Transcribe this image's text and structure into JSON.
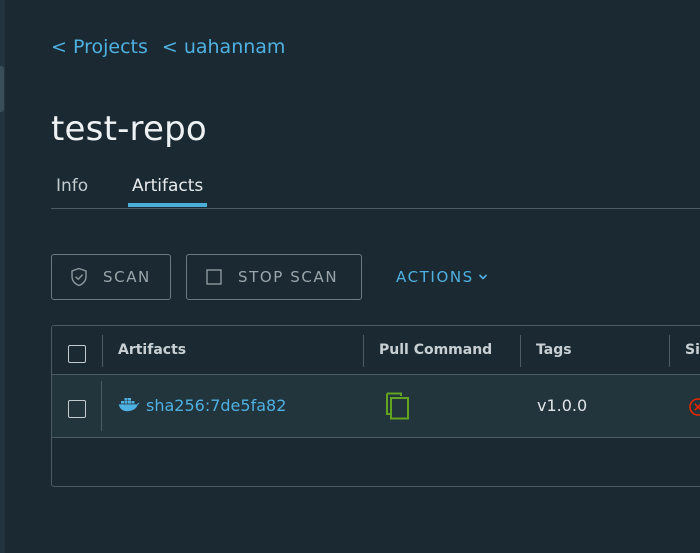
{
  "breadcrumb": {
    "projects": "< Projects",
    "project": "< uahannam"
  },
  "title": "test-repo",
  "tabs": [
    {
      "label": "Info",
      "active": false
    },
    {
      "label": "Artifacts",
      "active": true
    }
  ],
  "toolbar": {
    "scan_label": "SCAN",
    "stop_scan_label": "STOP SCAN",
    "actions_label": "ACTIONS"
  },
  "table": {
    "columns": [
      "Artifacts",
      "Pull Command",
      "Tags",
      "Si"
    ],
    "rows": [
      {
        "artifact": "sha256:7de5fa82",
        "tags": "v1.0.0",
        "icons": {
          "type": "docker-icon",
          "pull": "copy-icon",
          "signed": "error-circle-icon"
        }
      }
    ]
  },
  "colors": {
    "background": "#1b2a32",
    "link": "#4fb0e2",
    "copy_icon": "#62a420",
    "error": "#e62700"
  }
}
